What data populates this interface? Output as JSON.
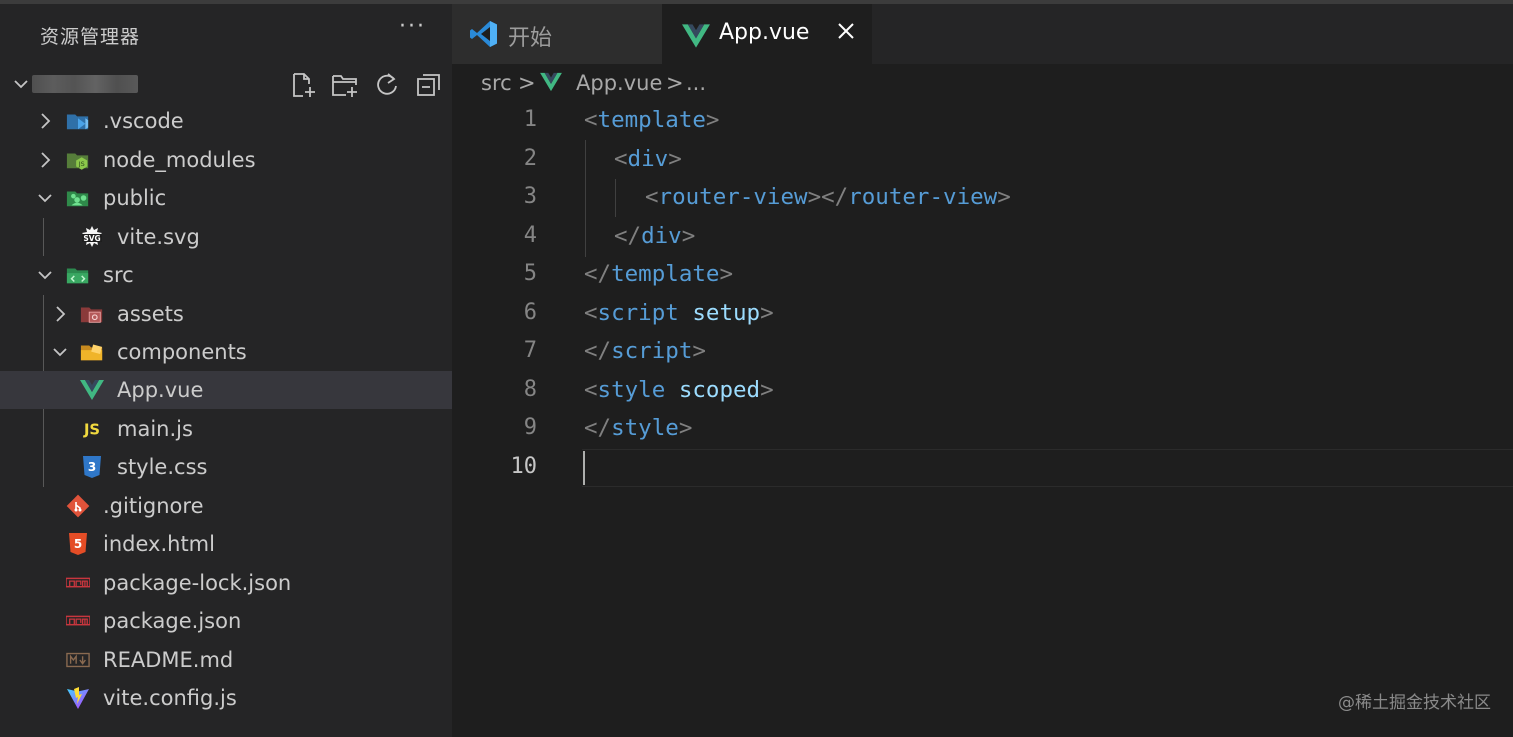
{
  "sidebar": {
    "title": "资源管理器",
    "more": "···",
    "items": [
      {
        "label": ".vscode",
        "icon": "vscode-folder-icon"
      },
      {
        "label": "node_modules",
        "icon": "node-folder-icon"
      },
      {
        "label": "public",
        "icon": "public-folder-icon"
      },
      {
        "label": "vite.svg",
        "icon": "svg-file-icon"
      },
      {
        "label": "src",
        "icon": "src-folder-icon"
      },
      {
        "label": "assets",
        "icon": "assets-folder-icon"
      },
      {
        "label": "components",
        "icon": "components-folder-icon"
      },
      {
        "label": "App.vue",
        "icon": "vue-file-icon"
      },
      {
        "label": "main.js",
        "icon": "js-file-icon"
      },
      {
        "label": "style.css",
        "icon": "css-file-icon"
      },
      {
        "label": ".gitignore",
        "icon": "git-file-icon"
      },
      {
        "label": "index.html",
        "icon": "html-file-icon"
      },
      {
        "label": "package-lock.json",
        "icon": "npm-file-icon"
      },
      {
        "label": "package.json",
        "icon": "npm-file-icon"
      },
      {
        "label": "README.md",
        "icon": "markdown-file-icon"
      },
      {
        "label": "vite.config.js",
        "icon": "vite-file-icon"
      }
    ]
  },
  "tabs": [
    {
      "label": "开始",
      "icon": "vscode-logo-icon",
      "active": false
    },
    {
      "label": "App.vue",
      "icon": "vue-file-icon",
      "active": true
    }
  ],
  "breadcrumb": {
    "part1": "src",
    "sep": ">",
    "part2": "App.vue",
    "part3": "..."
  },
  "editor": {
    "line_numbers": [
      "1",
      "2",
      "3",
      "4",
      "5",
      "6",
      "7",
      "8",
      "9",
      "10"
    ],
    "current_line": "10",
    "lines": {
      "l1": {
        "open": "<",
        "tag": "template",
        "close": ">"
      },
      "l2": {
        "open": "<",
        "tag": "div",
        "close": ">"
      },
      "l3": {
        "open": "<",
        "tag": "router-view",
        "mid": "></",
        "tag2": "router-view",
        "close": ">"
      },
      "l4": {
        "open": "</",
        "tag": "div",
        "close": ">"
      },
      "l5": {
        "open": "</",
        "tag": "template",
        "close": ">"
      },
      "l6": {
        "open": "<",
        "tag": "script",
        "attr": "setup",
        "close": ">"
      },
      "l7": {
        "open": "</",
        "tag": "script",
        "close": ">"
      },
      "l8": {
        "open": "<",
        "tag": "style",
        "attr": "scoped",
        "close": ">"
      },
      "l9": {
        "open": "</",
        "tag": "style",
        "close": ">"
      }
    }
  },
  "watermark": "@稀土掘金技术社区",
  "colors": {
    "sidebar_bg": "#252526",
    "editor_bg": "#1e1e1e",
    "selection_bg": "#37373d",
    "tag_blue": "#569cd6",
    "attr_blue": "#9cdcfe",
    "bracket_gray": "#808080",
    "vue_green": "#41b883"
  }
}
